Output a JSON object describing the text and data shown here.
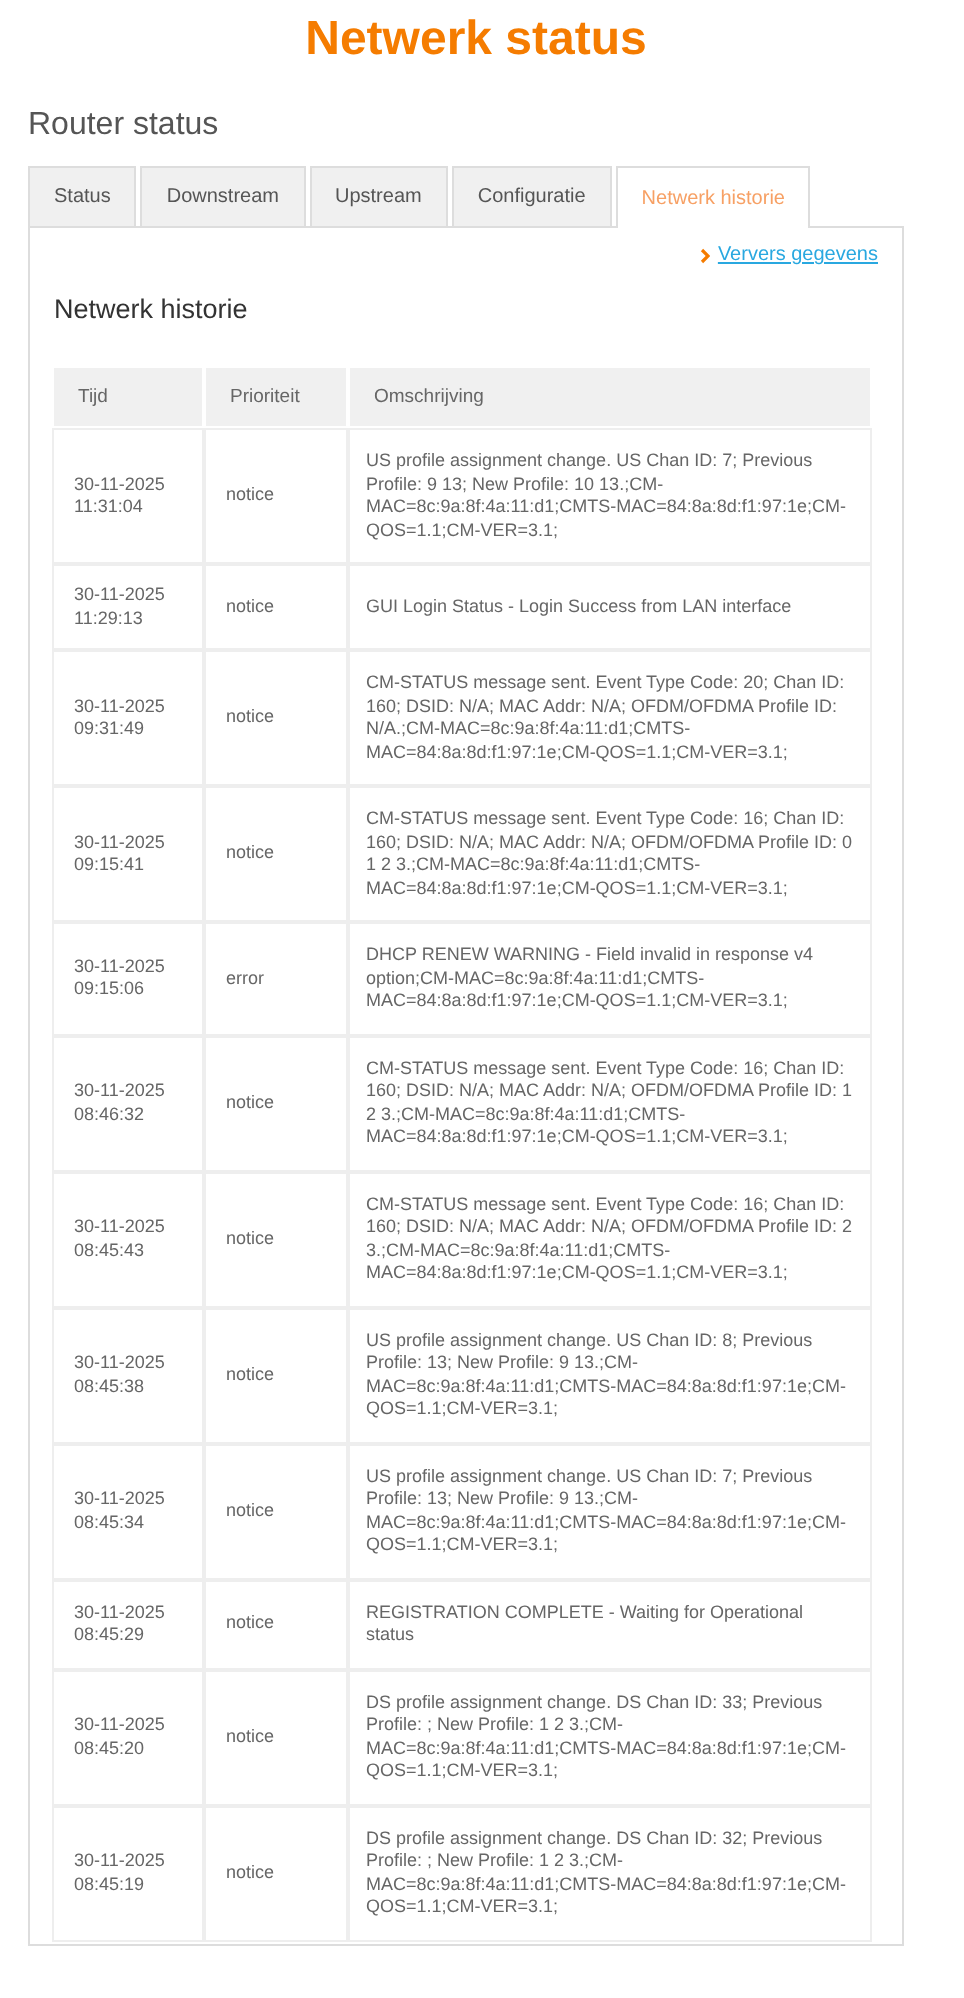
{
  "page_title": "Netwerk status",
  "section_title": "Router status",
  "tabs": [
    {
      "label": "Status",
      "selected": false
    },
    {
      "label": "Downstream",
      "selected": false
    },
    {
      "label": "Upstream",
      "selected": false
    },
    {
      "label": "Configuratie",
      "selected": false
    },
    {
      "label": "Netwerk historie",
      "selected": true
    }
  ],
  "refresh_link": "Ververs gegevens",
  "panel_title": "Netwerk historie",
  "table": {
    "columns": [
      "Tijd",
      "Prioriteit",
      "Omschrijving"
    ],
    "rows": [
      {
        "date": "30-11-2025",
        "time": "11:31:04",
        "priority": "notice",
        "description": "US profile assignment change. US Chan ID: 7; Previous Profile: 9 13; New Profile: 10 13.;CM-MAC=8c:9a:8f:4a:11:d1;CMTS-MAC=84:8a:8d:f1:97:1e;CM-QOS=1.1;CM-VER=3.1;"
      },
      {
        "date": "30-11-2025",
        "time": "11:29:13",
        "priority": "notice",
        "description": "GUI Login Status - Login Success from LAN interface"
      },
      {
        "date": "30-11-2025",
        "time": "09:31:49",
        "priority": "notice",
        "description": "CM-STATUS message sent. Event Type Code: 20; Chan ID: 160; DSID: N/A; MAC Addr: N/A; OFDM/OFDMA Profile ID: N/A.;CM-MAC=8c:9a:8f:4a:11:d1;CMTS-MAC=84:8a:8d:f1:97:1e;CM-QOS=1.1;CM-VER=3.1;"
      },
      {
        "date": "30-11-2025",
        "time": "09:15:41",
        "priority": "notice",
        "description": "CM-STATUS message sent. Event Type Code: 16; Chan ID: 160; DSID: N/A; MAC Addr: N/A; OFDM/OFDMA Profile ID: 0 1 2 3.;CM-MAC=8c:9a:8f:4a:11:d1;CMTS-MAC=84:8a:8d:f1:97:1e;CM-QOS=1.1;CM-VER=3.1;"
      },
      {
        "date": "30-11-2025",
        "time": "09:15:06",
        "priority": "error",
        "description": "DHCP RENEW WARNING - Field invalid in response v4 option;CM-MAC=8c:9a:8f:4a:11:d1;CMTS-MAC=84:8a:8d:f1:97:1e;CM-QOS=1.1;CM-VER=3.1;"
      },
      {
        "date": "30-11-2025",
        "time": "08:46:32",
        "priority": "notice",
        "description": "CM-STATUS message sent. Event Type Code: 16; Chan ID: 160; DSID: N/A; MAC Addr: N/A; OFDM/OFDMA Profile ID: 1 2 3.;CM-MAC=8c:9a:8f:4a:11:d1;CMTS-MAC=84:8a:8d:f1:97:1e;CM-QOS=1.1;CM-VER=3.1;"
      },
      {
        "date": "30-11-2025",
        "time": "08:45:43",
        "priority": "notice",
        "description": "CM-STATUS message sent. Event Type Code: 16; Chan ID: 160; DSID: N/A; MAC Addr: N/A; OFDM/OFDMA Profile ID: 2 3.;CM-MAC=8c:9a:8f:4a:11:d1;CMTS-MAC=84:8a:8d:f1:97:1e;CM-QOS=1.1;CM-VER=3.1;"
      },
      {
        "date": "30-11-2025",
        "time": "08:45:38",
        "priority": "notice",
        "description": "US profile assignment change. US Chan ID: 8; Previous Profile: 13; New Profile: 9 13.;CM-MAC=8c:9a:8f:4a:11:d1;CMTS-MAC=84:8a:8d:f1:97:1e;CM-QOS=1.1;CM-VER=3.1;"
      },
      {
        "date": "30-11-2025",
        "time": "08:45:34",
        "priority": "notice",
        "description": "US profile assignment change. US Chan ID: 7; Previous Profile: 13; New Profile: 9 13.;CM-MAC=8c:9a:8f:4a:11:d1;CMTS-MAC=84:8a:8d:f1:97:1e;CM-QOS=1.1;CM-VER=3.1;"
      },
      {
        "date": "30-11-2025",
        "time": "08:45:29",
        "priority": "notice",
        "description": "REGISTRATION COMPLETE - Waiting for Operational status"
      },
      {
        "date": "30-11-2025",
        "time": "08:45:20",
        "priority": "notice",
        "description": "DS profile assignment change. DS Chan ID: 33; Previous Profile: ; New Profile: 1 2 3.;CM-MAC=8c:9a:8f:4a:11:d1;CMTS-MAC=84:8a:8d:f1:97:1e;CM-QOS=1.1;CM-VER=3.1;"
      },
      {
        "date": "30-11-2025",
        "time": "08:45:19",
        "priority": "notice",
        "description": "DS profile assignment change. DS Chan ID: 32; Previous Profile: ; New Profile: 1 2 3.;CM-MAC=8c:9a:8f:4a:11:d1;CMTS-MAC=84:8a:8d:f1:97:1e;CM-QOS=1.1;CM-VER=3.1;"
      }
    ]
  }
}
